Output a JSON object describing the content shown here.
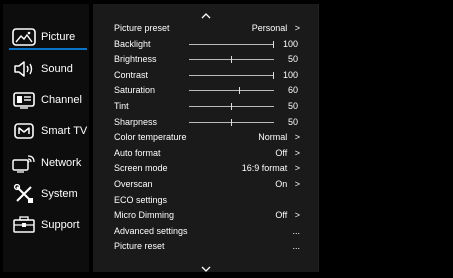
{
  "sidebar": {
    "items": [
      {
        "label": "Picture",
        "icon": "picture-icon",
        "selected": true
      },
      {
        "label": "Sound",
        "icon": "speaker-icon"
      },
      {
        "label": "Channel",
        "icon": "channel-icon"
      },
      {
        "label": "Smart TV",
        "icon": "smart-tv-icon"
      },
      {
        "label": "Network",
        "icon": "network-icon"
      },
      {
        "label": "System",
        "icon": "tools-icon"
      },
      {
        "label": "Support",
        "icon": "support-icon"
      }
    ],
    "accent": "#0a73c8"
  },
  "menu": {
    "rows": [
      {
        "label": "Picture preset",
        "value": "Personal",
        "arrow": ">"
      },
      {
        "label": "Backlight",
        "slider": 100,
        "num": "100"
      },
      {
        "label": "Brightness",
        "slider": 50,
        "num": "50"
      },
      {
        "label": "Contrast",
        "slider": 100,
        "num": "100"
      },
      {
        "label": "Saturation",
        "slider": 60,
        "num": "60"
      },
      {
        "label": "Tint",
        "slider": 50,
        "num": "50"
      },
      {
        "label": "Sharpness",
        "slider": 50,
        "num": "50"
      },
      {
        "label": "Color temperature",
        "value": "Normal",
        "arrow": ">"
      },
      {
        "label": "Auto format",
        "value": "Off",
        "arrow": ">"
      },
      {
        "label": "Screen mode",
        "value": "16:9 format",
        "arrow": ">"
      },
      {
        "label": "Overscan",
        "value": "On",
        "arrow": ">"
      },
      {
        "label": "ECO settings"
      },
      {
        "label": "Micro Dimming",
        "value": "Off",
        "arrow": ">"
      },
      {
        "label": "Advanced settings",
        "ellipsis": "..."
      },
      {
        "label": "Picture reset",
        "ellipsis": "..."
      }
    ]
  }
}
